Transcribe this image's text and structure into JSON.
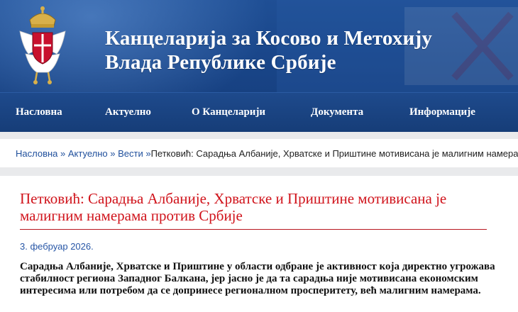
{
  "header": {
    "title_line1": "Канцеларија за Косово и Метохију",
    "title_line2": "Влада Републике Србије",
    "logo_icon": "coat-of-arms-serbia-icon",
    "colors": {
      "header_blue": "#1a478b",
      "nav_blue": "#163d78",
      "accent_red": "#d0131b",
      "link_blue": "#1f4f9c"
    }
  },
  "nav": {
    "items": [
      {
        "label": "Насловна"
      },
      {
        "label": "Актуелно"
      },
      {
        "label": "О Канцеларији"
      },
      {
        "label": "Документа"
      },
      {
        "label": "Информације"
      }
    ]
  },
  "breadcrumb": {
    "home": "Насловна",
    "sep1": " » ",
    "section": "Актуелно",
    "sep2": " » ",
    "subsection": "Вести",
    "sep3": " »",
    "current": "Петковић: Сарадња Албаније, Хрватске и Приштине мотивисана је малигним намерама"
  },
  "article": {
    "title": "Петковић: Сарадња Албаније, Хрватске и Приштине мотивисана је малигним намерама против Србије",
    "date": "3. фебруар 2026.",
    "lead": "Сарадња Албаније, Хрватске и Приштине у области одбране је активност која директно угрожава стабилност региона Западног Балкана, јер јасно је да та сарадња није мотивисана економским интересима или потребом да се допринесе регионалном просперитету, већ малигним намерама."
  }
}
